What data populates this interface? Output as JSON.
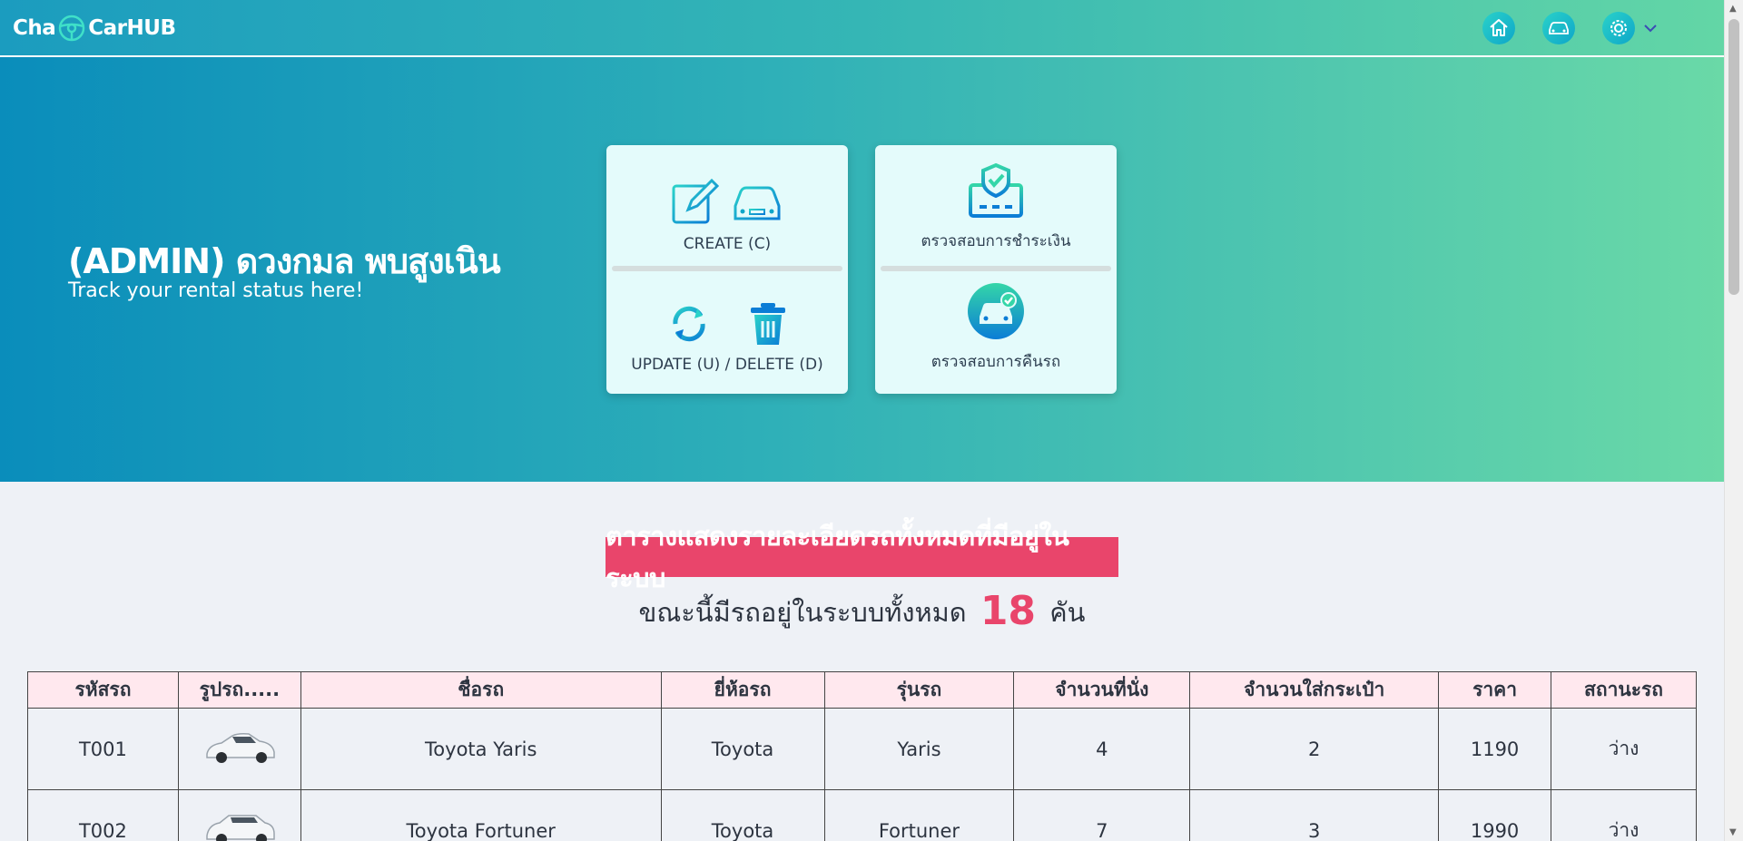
{
  "header": {
    "brand_left": "Cha",
    "brand_right": "CarHUB",
    "nav": [
      "home-icon",
      "car-icon",
      "settings-icon"
    ]
  },
  "hero": {
    "title": "(ADMIN) ดวงกมล พบสูงเนิน",
    "subtitle": "Track your rental status here!"
  },
  "actions": {
    "create": "CREATE (C)",
    "update_delete": "UPDATE (U) / DELETE (D)",
    "payment_check": "ตรวจสอบการชำระเงิน",
    "return_check": "ตรวจสอบการคืนรถ"
  },
  "summary": {
    "heading": "ตารางแสดงรายละเอียดรถทั้งหมดที่มีอยู่ในระบบ",
    "prefix": "ขณะนี้มีรถอยู่ในระบบทั้งหมด",
    "count": "18",
    "suffix": "คัน"
  },
  "table": {
    "headers": [
      "รหัสรถ",
      "รูปรถ.....",
      "ชื่อรถ",
      "ยี่ห้อรถ",
      "รุ่นรถ",
      "จำนวนที่นั่ง",
      "จำนวนใส่กระเป๋า",
      "ราคา",
      "สถานะรถ"
    ],
    "rows": [
      {
        "id": "T001",
        "name": "Toyota Yaris",
        "brand": "Toyota",
        "model": "Yaris",
        "seats": "4",
        "bags": "2",
        "price": "1190",
        "status": "ว่าง"
      },
      {
        "id": "T002",
        "name": "Toyota Fortuner",
        "brand": "Toyota",
        "model": "Fortuner",
        "seats": "7",
        "bags": "3",
        "price": "1990",
        "status": "ว่าง"
      }
    ]
  },
  "colors": {
    "accent_pink": "#e9456b",
    "gradient_start": "#0a8dbb",
    "gradient_end": "#6ad9a7",
    "card_bg": "#e4fbfb"
  }
}
